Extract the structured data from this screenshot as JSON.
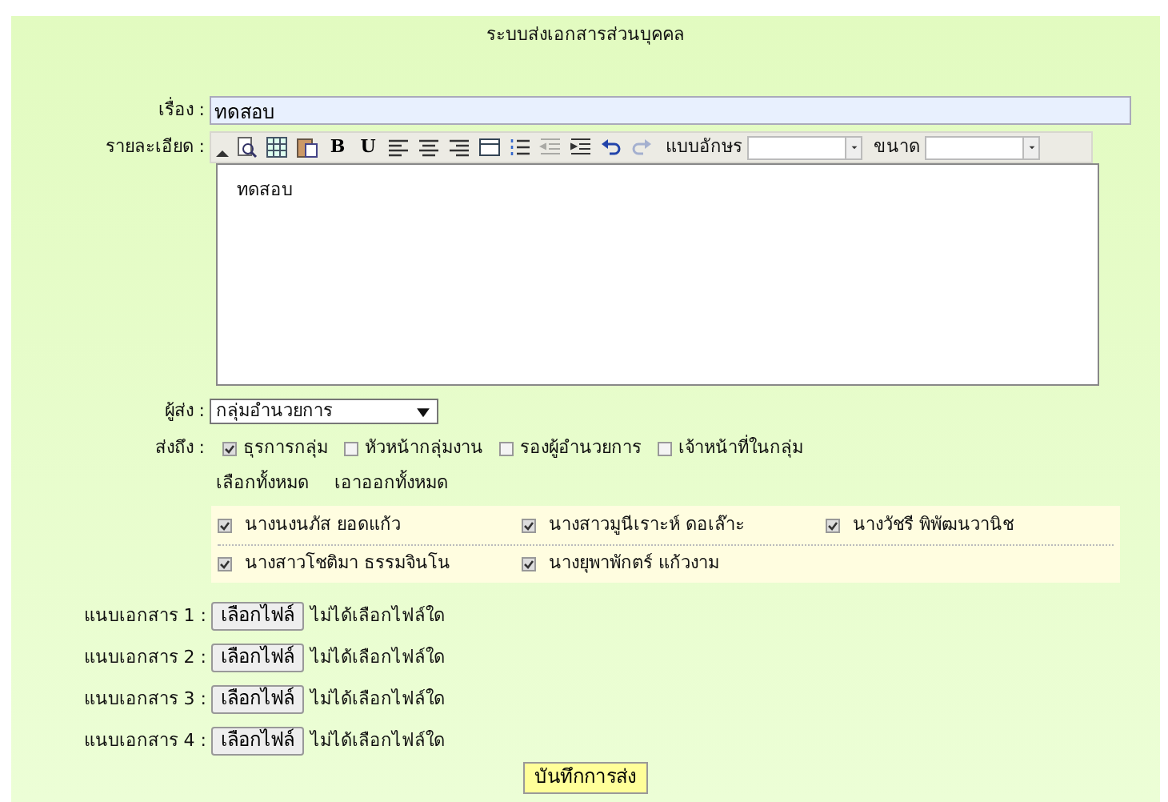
{
  "title": "ระบบส่งเอกสารส่วนบุคคล",
  "subject": {
    "label": "เรื่อง :",
    "value": "ทดสอบ"
  },
  "detail": {
    "label": "รายละเอียด :",
    "toolbar": [
      {
        "kind": "preview",
        "disabled": false
      },
      {
        "kind": "table",
        "disabled": false
      },
      {
        "kind": "paste",
        "disabled": false
      },
      {
        "kind": "text",
        "text": "B",
        "disabled": false
      },
      {
        "kind": "text",
        "text": "U",
        "disabled": false
      },
      {
        "kind": "align-left",
        "disabled": false
      },
      {
        "kind": "align-center",
        "disabled": false
      },
      {
        "kind": "align-right",
        "disabled": false
      },
      {
        "kind": "rule",
        "disabled": false
      },
      {
        "kind": "list",
        "disabled": false
      },
      {
        "kind": "outdent",
        "disabled": true
      },
      {
        "kind": "indent",
        "disabled": false
      },
      {
        "kind": "undo",
        "disabled": false
      },
      {
        "kind": "redo",
        "disabled": true
      }
    ],
    "font_label": "แบบอักษร",
    "size_label": "ขนาด",
    "body": "ทดสอบ"
  },
  "sender": {
    "label": "ผู้ส่ง :",
    "value": "กลุ่มอำนวยการ"
  },
  "recipients": {
    "label": "ส่งถึง :",
    "groups": [
      {
        "label": "ธุรการกลุ่ม",
        "checked": true
      },
      {
        "label": "หัวหน้ากลุ่มงาน",
        "checked": false
      },
      {
        "label": "รองผู้อำนวยการ",
        "checked": false
      },
      {
        "label": "เจ้าหน้าที่ในกลุ่ม",
        "checked": false
      }
    ],
    "select_all": "เลือกทั้งหมด",
    "deselect_all": "เอาออกทั้งหมด",
    "people": [
      {
        "label": "นางนงนภัส ยอดแก้ว",
        "checked": true
      },
      {
        "label": "นางสาวมูนีเราะห์ ดอเล๊าะ",
        "checked": true
      },
      {
        "label": "นางวัชรี พิพัฒนวานิช",
        "checked": true
      },
      {
        "label": "นางสาวโชติมา ธรรมจินโน",
        "checked": true
      },
      {
        "label": "นางยุพาพักตร์ แก้วงาม",
        "checked": true
      }
    ]
  },
  "attachments": [
    {
      "label": "แนบเอกสาร 1 :",
      "button": "เลือกไฟล์",
      "status": "ไม่ได้เลือกไฟล์ใด"
    },
    {
      "label": "แนบเอกสาร 2 :",
      "button": "เลือกไฟล์",
      "status": "ไม่ได้เลือกไฟล์ใด"
    },
    {
      "label": "แนบเอกสาร 3 :",
      "button": "เลือกไฟล์",
      "status": "ไม่ได้เลือกไฟล์ใด"
    },
    {
      "label": "แนบเอกสาร 4 :",
      "button": "เลือกไฟล์",
      "status": "ไม่ได้เลือกไฟล์ใด"
    }
  ],
  "submit": "บันทึกการส่ง"
}
